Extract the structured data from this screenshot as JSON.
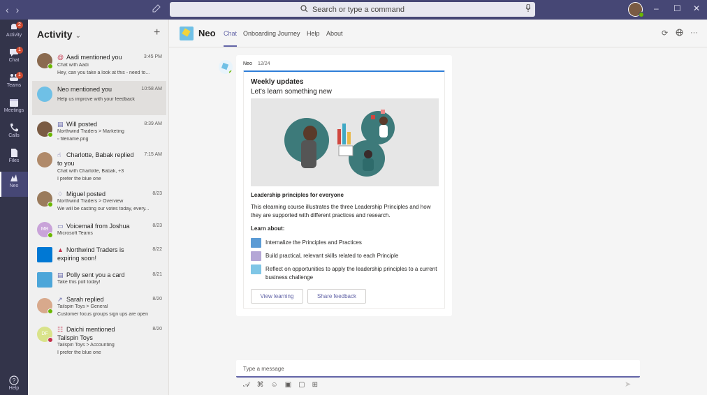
{
  "window": {
    "search_placeholder": "Search or type a command",
    "back_icon": "chevron-left-icon",
    "forward_icon": "chevron-right-icon"
  },
  "rail": {
    "items": [
      {
        "label": "Activity",
        "icon": "bell-icon",
        "badge": "2"
      },
      {
        "label": "Chat",
        "icon": "chat-icon",
        "badge": "1"
      },
      {
        "label": "Teams",
        "icon": "teams-icon",
        "badge": "1"
      },
      {
        "label": "Meetings",
        "icon": "calendar-icon",
        "badge": ""
      },
      {
        "label": "Calls",
        "icon": "phone-icon",
        "badge": ""
      },
      {
        "label": "Files",
        "icon": "file-icon",
        "badge": ""
      },
      {
        "label": "Neo",
        "icon": "neo-icon",
        "badge": ""
      }
    ],
    "help": "Help"
  },
  "activity": {
    "title": "Activity",
    "feed": [
      {
        "title": "Aadi mentioned you",
        "time": "3:45 PM",
        "lines": [
          "Chat with Aadi",
          "Hey, can you take a look at this - need to..."
        ]
      },
      {
        "title": "Neo mentioned you",
        "time": "10:58 AM",
        "lines": [
          "Help us improve with your feedback"
        ]
      },
      {
        "title": "Will posted",
        "time": "8:39 AM",
        "lines": [
          "Northwind Traders > Marketing",
          "filename.png"
        ]
      },
      {
        "title": "Charlotte, Babak replied",
        "title2": "to you",
        "time": "7:15 AM",
        "lines": [
          "Chat with Charlotte, Babak, +3",
          "I prefer the blue one"
        ]
      },
      {
        "title": "Miguel posted",
        "time": "8/23",
        "lines": [
          "Northwind Traders > Overview",
          "We will be casting our votes today, every..."
        ]
      },
      {
        "title": "Voicemail from Joshua",
        "time": "8/23",
        "lines": [
          "Microsoft Teams"
        ],
        "initials": "MB"
      },
      {
        "title": "Northwind Traders is",
        "title2": "expiring soon!",
        "time": "8/22",
        "lines": []
      },
      {
        "title": "Polly sent you a card",
        "time": "8/21",
        "lines": [
          "Take this poll today!"
        ]
      },
      {
        "title": "Sarah replied",
        "time": "8/20",
        "lines": [
          "Tailspin Toys > General",
          "Customer focus groups sign ups are open"
        ]
      },
      {
        "title": "Daichi mentioned",
        "title2": "Tailspin Toys",
        "time": "8/20",
        "lines": [
          "Tailspin Toys > Accounting",
          "I prefer the blue one"
        ],
        "initials": "DF"
      }
    ]
  },
  "app": {
    "name": "Neo",
    "tabs": [
      "Chat",
      "Onboarding Journey",
      "Help",
      "About"
    ]
  },
  "message": {
    "sender": "Neo",
    "date": "12/24",
    "card": {
      "heading": "Weekly updates",
      "subheading": "Let's learn something new",
      "section_title": "Leadership principles for everyone",
      "body": "This elearning course illustrates the three Leadership Principles and how they are supported with different practices and research.",
      "learn_label": "Learn about:",
      "items": [
        "Internalize the Principles and Practices",
        "Build practical, relevant skills related to each Principle",
        "Reflect on opportunities to apply the leadership principles to a current business challenge"
      ],
      "buttons": [
        "View learning",
        "Share feedback"
      ]
    }
  },
  "composer": {
    "placeholder": "Type a message"
  },
  "colors": {
    "accent": "#6264a7",
    "titlebar": "#464775",
    "rail": "#33344a",
    "presence": "#6bb700",
    "badge": "#cc4a31"
  }
}
